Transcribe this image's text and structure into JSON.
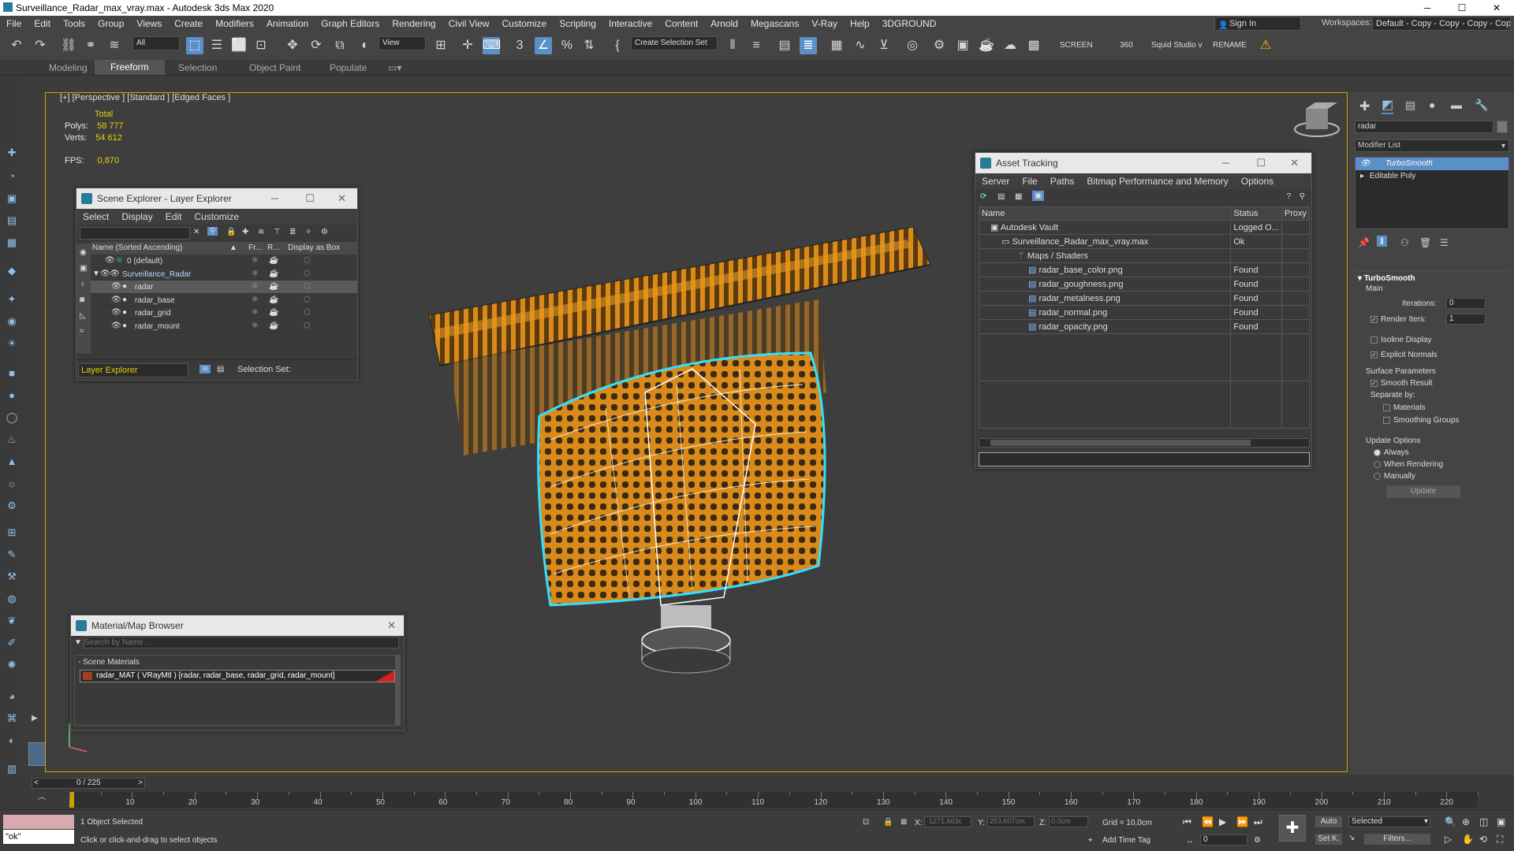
{
  "window": {
    "title": "Surveillance_Radar_max_vray.max - Autodesk 3ds Max 2020",
    "min": "─",
    "max": "☐",
    "close": "✕"
  },
  "menu": [
    "File",
    "Edit",
    "Tools",
    "Group",
    "Views",
    "Create",
    "Modifiers",
    "Animation",
    "Graph Editors",
    "Rendering",
    "Civil View",
    "Customize",
    "Scripting",
    "Interactive",
    "Content",
    "Arnold",
    "Megascans",
    "V-Ray",
    "Help",
    "3DGROUND"
  ],
  "signin": "Sign In",
  "workspaces": {
    "label": "Workspaces:",
    "value": "Default - Copy - Copy - Copy - Copy"
  },
  "toolbar": {
    "filter": "All",
    "view": "View",
    "selection_set": "Create Selection Set",
    "screen": "SCREEN",
    "num360": "360",
    "squid": "Squid Studio v",
    "rename": "RENAME"
  },
  "ribbon": [
    "Modeling",
    "Freeform",
    "Selection",
    "Object Paint",
    "Populate"
  ],
  "viewport": {
    "label": "[+] [Perspective ] [Standard ] [Edged Faces ]",
    "stats": {
      "total": "Total",
      "polys_label": "Polys:",
      "polys": "58 777",
      "verts_label": "Verts:",
      "verts": "54 612",
      "fps_label": "FPS:",
      "fps": "0,870"
    }
  },
  "scene_explorer": {
    "title": "Scene Explorer - Layer Explorer",
    "menu": [
      "Select",
      "Display",
      "Edit",
      "Customize"
    ],
    "columns": {
      "name": "Name (Sorted Ascending)",
      "fr": "Fr...",
      "r": "R...",
      "box": "Display as Box"
    },
    "rows": [
      {
        "name": "0 (default)",
        "level": 0
      },
      {
        "name": "Surveillance_Radar",
        "level": 0
      },
      {
        "name": "radar",
        "level": 1
      },
      {
        "name": "radar_base",
        "level": 1
      },
      {
        "name": "radar_grid",
        "level": 1
      },
      {
        "name": "radar_mount",
        "level": 1
      }
    ],
    "footer": {
      "layer": "Layer Explorer",
      "selset": "Selection Set:"
    }
  },
  "asset_tracking": {
    "title": "Asset Tracking",
    "menu": [
      "Server",
      "File",
      "Paths",
      "Bitmap Performance and Memory",
      "Options"
    ],
    "columns": {
      "name": "Name",
      "status": "Status",
      "proxy": "Proxy"
    },
    "rows": [
      {
        "name": "Autodesk Vault",
        "status": "Logged O...",
        "indent": 0
      },
      {
        "name": "Surveillance_Radar_max_vray.max",
        "status": "Ok",
        "indent": 1
      },
      {
        "name": "Maps / Shaders",
        "status": "",
        "indent": 2
      },
      {
        "name": "radar_base_color.png",
        "status": "Found",
        "indent": 3
      },
      {
        "name": "radar_goughness.png",
        "status": "Found",
        "indent": 3
      },
      {
        "name": "radar_metalness.png",
        "status": "Found",
        "indent": 3
      },
      {
        "name": "radar_normal.png",
        "status": "Found",
        "indent": 3
      },
      {
        "name": "radar_opacity.png",
        "status": "Found",
        "indent": 3
      }
    ]
  },
  "material_browser": {
    "title": "Material/Map Browser",
    "search_placeholder": "Search by Name ...",
    "section": "- Scene Materials",
    "material": "radar_MAT  ( VRayMtl )  [radar, radar_base, radar_grid, radar_mount]"
  },
  "command_panel": {
    "search_value": "radar",
    "modifier_list": "Modifier List",
    "stack": [
      "TurboSmooth",
      "Editable Poly"
    ],
    "rollout": {
      "title": "TurboSmooth",
      "main": "Main",
      "iterations_label": "Iterations:",
      "iterations": "0",
      "render_iters_label": "Render Iters:",
      "render_iters": "1",
      "isoline": "Isoline Display",
      "explicit_normals": "Explicit Normals",
      "surface_params": "Surface Parameters",
      "smooth_result": "Smooth Result",
      "separate_by": "Separate by:",
      "materials": "Materials",
      "smoothing_groups": "Smoothing Groups",
      "update_options": "Update Options",
      "always": "Always",
      "when_rendering": "When Rendering",
      "manually": "Manually",
      "update": "Update"
    }
  },
  "timeline": {
    "frame": "0 / 225",
    "ticks": [
      "10",
      "20",
      "30",
      "40",
      "50",
      "60",
      "70",
      "80",
      "90",
      "100",
      "110",
      "120",
      "130",
      "140",
      "150",
      "160",
      "170",
      "180",
      "190",
      "200",
      "210",
      "220"
    ]
  },
  "status": {
    "maxscript": "\"ok\"",
    "selected": "1 Object Selected",
    "prompt": "Click or click-and-drag to select objects",
    "x_label": "X:",
    "x": "-1271,663c",
    "y_label": "Y:",
    "y": "253,607cm",
    "z_label": "Z:",
    "z": "0,0cm",
    "grid": "Grid = 10,0cm",
    "add_time_tag": "Add Time Tag",
    "auto": "Auto",
    "selected_dd": "Selected",
    "setk": "Set K.",
    "filters": "Filters...",
    "frame_field": "0"
  }
}
